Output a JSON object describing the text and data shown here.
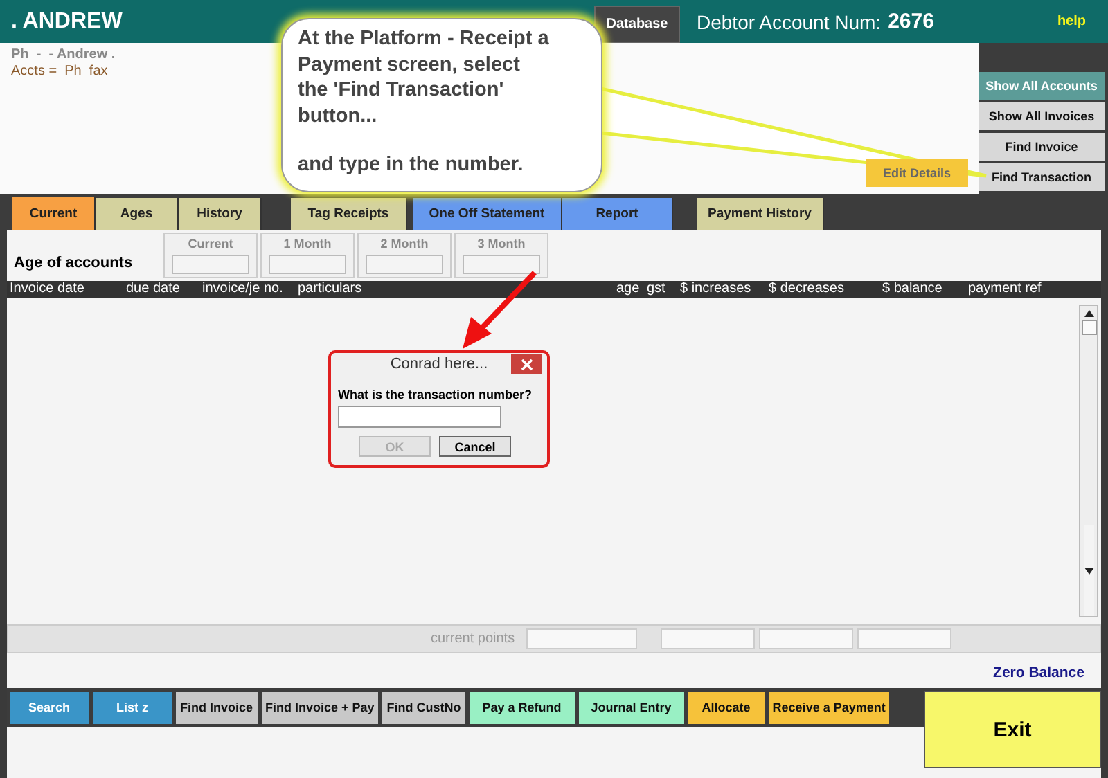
{
  "header": {
    "title": ". ANDREW",
    "database_tab": "Database",
    "account_label": "Debtor Account Num:",
    "account_number": "2676",
    "help": "help"
  },
  "info": {
    "lines": [
      "Ph  -  - Andrew .",
      "Accts =  Ph  fax"
    ],
    "edit_button": "Edit Details"
  },
  "side_buttons": [
    {
      "label": "Show All Accounts",
      "selected": true
    },
    {
      "label": "Show All Invoices",
      "selected": false
    },
    {
      "label": "Find Invoice",
      "selected": false
    },
    {
      "label": "Find Transaction",
      "selected": false
    }
  ],
  "tabs": [
    {
      "label": "Current",
      "selected": true,
      "color": "#f7a043"
    },
    {
      "label": "Ages",
      "selected": false,
      "color": "#d4d29e"
    },
    {
      "label": "History",
      "selected": false,
      "color": "#d4d29e"
    },
    {
      "label": "Tag Receipts",
      "selected": false,
      "color": "#d4d29e"
    },
    {
      "label": "One Off Statement",
      "selected": false,
      "color": "#6699ee"
    },
    {
      "label": "Report",
      "selected": false,
      "color": "#6699ee"
    },
    {
      "label": "Payment History",
      "selected": false,
      "color": "#d4d29e"
    }
  ],
  "ages": {
    "label": "Age of accounts",
    "columns": [
      "Current",
      "1 Month",
      "2 Month",
      "3 Month"
    ]
  },
  "table": {
    "columns": [
      "Invoice date",
      "due date",
      "invoice/je no.",
      "particulars",
      "age",
      "gst",
      "$ increases",
      "$ decreases",
      "$ balance",
      "payment ref"
    ]
  },
  "points": {
    "label": "current points"
  },
  "balance": "Zero Balance",
  "toolbar": [
    {
      "label": "Search",
      "color": "#3a95c8"
    },
    {
      "label": "List z",
      "color": "#3a95c8"
    },
    {
      "label": "Find Invoice",
      "color": "#c8c8c8"
    },
    {
      "label": "Find Invoice + Pay",
      "color": "#c8c8c8"
    },
    {
      "label": "Find CustNo",
      "color": "#c8c8c8"
    },
    {
      "label": "Pay a Refund",
      "color": "#99f0c4"
    },
    {
      "label": "Journal Entry",
      "color": "#99f0c4"
    },
    {
      "label": "Allocate",
      "color": "#f6c23a"
    },
    {
      "label": "Receive a Payment",
      "color": "#f6c23a"
    }
  ],
  "exit": "Exit",
  "callout": {
    "paragraphs": [
      "At the Platform - Receipt a Payment screen, select the 'Find Transaction' button...",
      "and type in the number."
    ]
  },
  "dialog": {
    "title": "Conrad here...",
    "prompt": "What is the transaction number?",
    "ok": {
      "label": "OK",
      "disabled": true
    },
    "cancel": {
      "label": "Cancel",
      "disabled": false
    }
  }
}
